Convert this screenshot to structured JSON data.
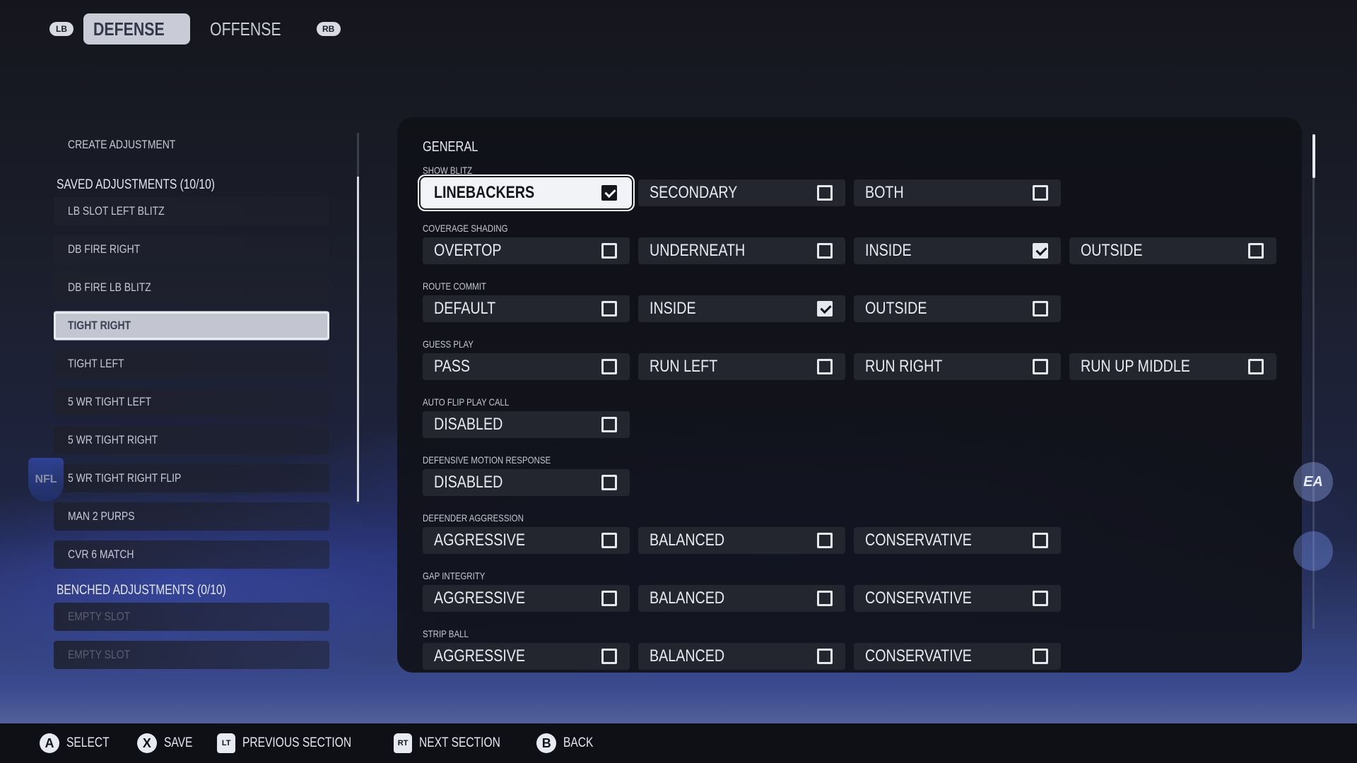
{
  "top_tabs": {
    "left_bumper": "LB",
    "right_bumper": "RB",
    "tabs": [
      "DEFENSE",
      "OFFENSE"
    ]
  },
  "left_panel": {
    "create_label": "CREATE ADJUSTMENT",
    "saved_header": "SAVED ADJUSTMENTS (10/10)",
    "saved_items": [
      "LB SLOT LEFT BLITZ",
      "DB FIRE RIGHT",
      "DB FIRE LB BLITZ",
      "TIGHT RIGHT",
      "TIGHT LEFT",
      "5 WR TIGHT LEFT",
      "5 WR TIGHT RIGHT",
      "5 WR TIGHT RIGHT FLIP",
      "MAN 2 PURPS",
      "CVR 6 MATCH"
    ],
    "selected_index": 3,
    "benched_header": "BENCHED ADJUSTMENTS (0/10)",
    "benched_items": [
      "EMPTY SLOT",
      "EMPTY SLOT"
    ]
  },
  "general": {
    "title": "GENERAL",
    "categories": [
      {
        "label": "SHOW BLITZ",
        "options": [
          {
            "label": "LINEBACKERS",
            "checked": true,
            "focused": true
          },
          {
            "label": "SECONDARY",
            "checked": false
          },
          {
            "label": "BOTH",
            "checked": false
          }
        ]
      },
      {
        "label": "COVERAGE SHADING",
        "options": [
          {
            "label": "OVERTOP",
            "checked": false
          },
          {
            "label": "UNDERNEATH",
            "checked": false
          },
          {
            "label": "INSIDE",
            "checked": true
          },
          {
            "label": "OUTSIDE",
            "checked": false
          }
        ]
      },
      {
        "label": "ROUTE COMMIT",
        "options": [
          {
            "label": "DEFAULT",
            "checked": false
          },
          {
            "label": "INSIDE",
            "checked": true
          },
          {
            "label": "OUTSIDE",
            "checked": false
          }
        ]
      },
      {
        "label": "GUESS PLAY",
        "options": [
          {
            "label": "PASS",
            "checked": false
          },
          {
            "label": "RUN LEFT",
            "checked": false
          },
          {
            "label": "RUN RIGHT",
            "checked": false
          },
          {
            "label": "RUN UP MIDDLE",
            "checked": false
          }
        ]
      },
      {
        "label": "AUTO FLIP PLAY CALL",
        "options": [
          {
            "label": "DISABLED",
            "checked": false
          }
        ]
      },
      {
        "label": "DEFENSIVE MOTION RESPONSE",
        "options": [
          {
            "label": "DISABLED",
            "checked": false
          }
        ]
      },
      {
        "label": "DEFENDER AGGRESSION",
        "options": [
          {
            "label": "AGGRESSIVE",
            "checked": false
          },
          {
            "label": "BALANCED",
            "checked": false
          },
          {
            "label": "CONSERVATIVE",
            "checked": false
          }
        ]
      },
      {
        "label": "GAP INTEGRITY",
        "options": [
          {
            "label": "AGGRESSIVE",
            "checked": false
          },
          {
            "label": "BALANCED",
            "checked": false
          },
          {
            "label": "CONSERVATIVE",
            "checked": false
          }
        ]
      },
      {
        "label": "STRIP BALL",
        "options": [
          {
            "label": "AGGRESSIVE",
            "checked": false
          },
          {
            "label": "BALANCED",
            "checked": false
          },
          {
            "label": "CONSERVATIVE",
            "checked": false
          }
        ]
      }
    ]
  },
  "side_logos": {
    "left": "NFL",
    "right": "EA"
  },
  "bottom_hints": [
    {
      "key": "A",
      "label": "SELECT",
      "kind": "button"
    },
    {
      "key": "X",
      "label": "SAVE",
      "kind": "button"
    },
    {
      "key": "LT",
      "label": "PREVIOUS SECTION",
      "kind": "trigger"
    },
    {
      "key": "RT",
      "label": "NEXT SECTION",
      "kind": "trigger"
    },
    {
      "key": "B",
      "label": "BACK",
      "kind": "button"
    }
  ]
}
